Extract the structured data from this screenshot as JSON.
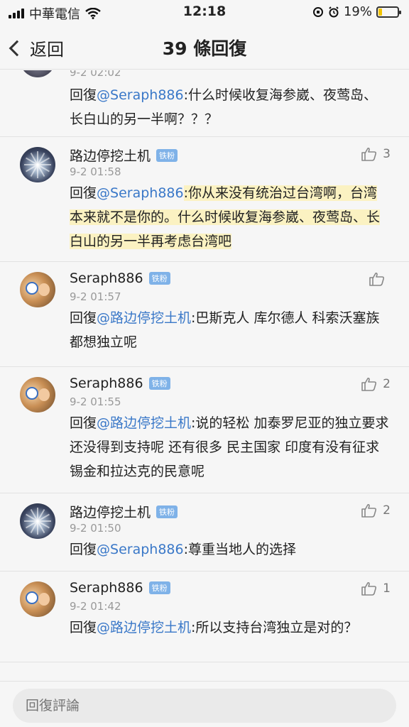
{
  "status": {
    "carrier": "中華電信",
    "time": "12:18",
    "battery": "19%",
    "battery_level": 0.19,
    "icons": [
      "signal-icon",
      "wifi-icon",
      "screen-lock-icon",
      "alarm-icon",
      "battery-icon"
    ]
  },
  "nav": {
    "back_label": "返回",
    "title": "39 條回復"
  },
  "partial": {
    "time": "9-2 02:02",
    "reply_prefix": "回復",
    "mention": "@Seraph886",
    "text": ":什么时候收复海参崴、夜莺岛、长白山的另一半啊？？？"
  },
  "items": [
    {
      "user": "路边停挖土机",
      "badge": "铁粉",
      "time": "9-2 01:58",
      "likes": "3",
      "reply_prefix": "回復",
      "mention": "@Seraph886",
      "text": ":你从来没有统治过台湾啊，台湾本来就不是你的。什么时候收复海参崴、夜莺岛、长白山的另一半再考虑台湾吧",
      "avatar": "road"
    },
    {
      "user": "Seraph886",
      "badge": "铁粉",
      "time": "9-2 01:57",
      "likes": "",
      "reply_prefix": "回復",
      "mention": "@路边停挖土机",
      "text": ":巴斯克人 库尔德人 科索沃塞族 都想独立呢",
      "avatar": "doll"
    },
    {
      "user": "Seraph886",
      "badge": "铁粉",
      "time": "9-2 01:55",
      "likes": "2",
      "reply_prefix": "回復",
      "mention": "@路边停挖土机",
      "text": ":说的轻松 加泰罗尼亚的独立要求还没得到支持呢 还有很多 民主国家 印度有没有征求锡金和拉达克的民意呢",
      "avatar": "doll"
    },
    {
      "user": "路边停挖土机",
      "badge": "铁粉",
      "time": "9-2 01:50",
      "likes": "2",
      "reply_prefix": "回復",
      "mention": "@Seraph886",
      "text": ":尊重当地人的选择",
      "avatar": "road"
    },
    {
      "user": "Seraph886",
      "badge": "铁粉",
      "time": "9-2 01:42",
      "likes": "1",
      "reply_prefix": "回復",
      "mention": "@路边停挖土机",
      "text": ":所以支持台湾独立是对的？",
      "avatar": "doll"
    }
  ],
  "bottom": {
    "placeholder": "回復評論"
  }
}
